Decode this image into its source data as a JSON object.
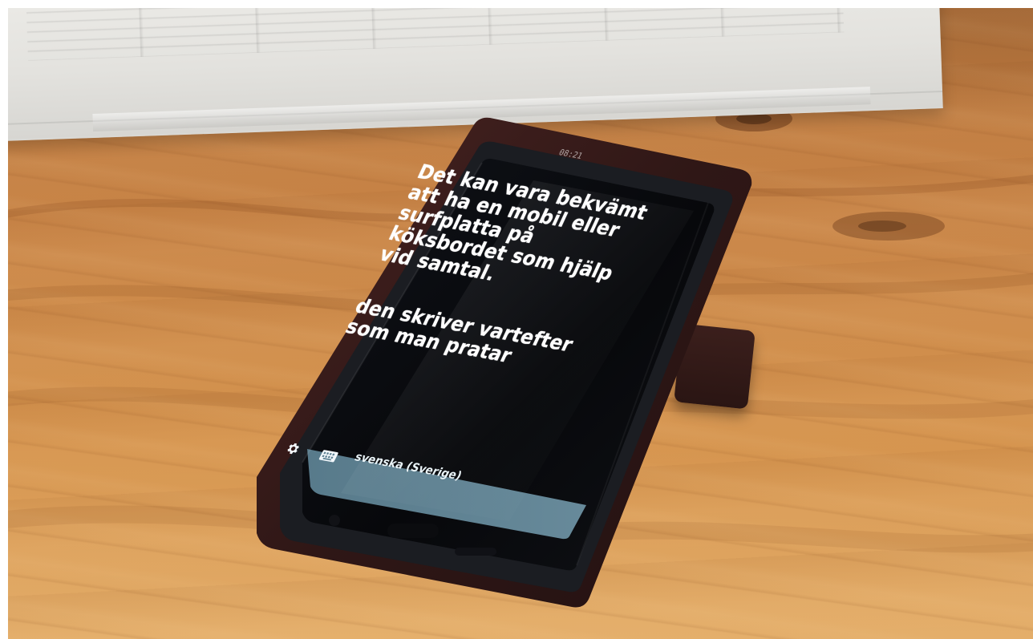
{
  "photo": {
    "title": ""
  },
  "phone_screen": {
    "status_time": "08:21",
    "transcript_blocks": [
      "Det kan vara bekvämt\natt ha en mobil eller\nsurfplatta på\nköksbordet som hjälp\nvid samtal.",
      "den skriver vartefter\nsom man pratar"
    ],
    "bottom_bar": {
      "language_label": "svenska (Sverige)",
      "settings_icon": "gear-icon",
      "keyboard_icon": "keyboard-icon"
    }
  },
  "colors": {
    "wood": "#d6954f",
    "newspaper": "#e6e5e1",
    "phone_case": "#3a1c1a",
    "screen_black": "#0d0f12",
    "bottom_bar": "#5e7f90",
    "text": "#ffffff"
  }
}
